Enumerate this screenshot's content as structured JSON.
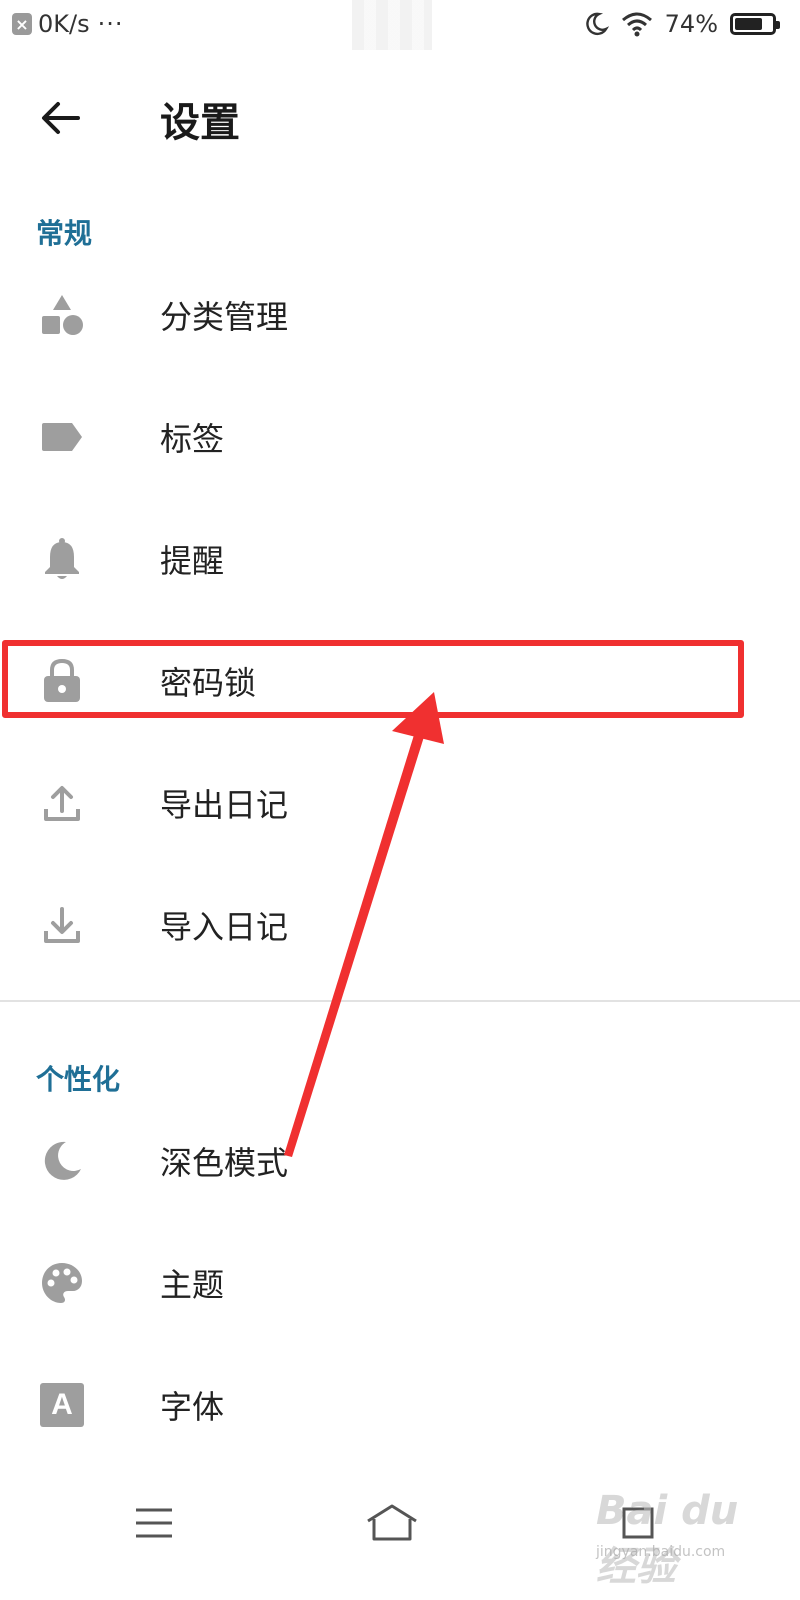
{
  "status_bar": {
    "net_speed": "0K/s",
    "more_dots": "···",
    "battery_percent": "74%",
    "battery_level": 0.74
  },
  "app_bar": {
    "title": "设置"
  },
  "sections": {
    "general": {
      "header": "常规",
      "items": [
        {
          "label": "分类管理",
          "icon": "category-shapes-icon"
        },
        {
          "label": "标签",
          "icon": "tag-icon"
        },
        {
          "label": "提醒",
          "icon": "bell-icon"
        },
        {
          "label": "密码锁",
          "icon": "lock-icon"
        },
        {
          "label": "导出日记",
          "icon": "upload-icon"
        },
        {
          "label": "导入日记",
          "icon": "download-icon"
        }
      ]
    },
    "personalize": {
      "header": "个性化",
      "items": [
        {
          "label": "深色模式",
          "icon": "moon-icon"
        },
        {
          "label": "主题",
          "icon": "palette-icon"
        },
        {
          "label": "字体",
          "icon": "font-icon"
        }
      ]
    }
  },
  "font_icon_letter": "A",
  "watermark": {
    "brand": "Bai du 经验",
    "sub": "jingyan.baidu.com"
  },
  "colors": {
    "accent": "#1f6f96",
    "icon_gray": "#9e9e9e",
    "annotation_red": "#f03030"
  }
}
